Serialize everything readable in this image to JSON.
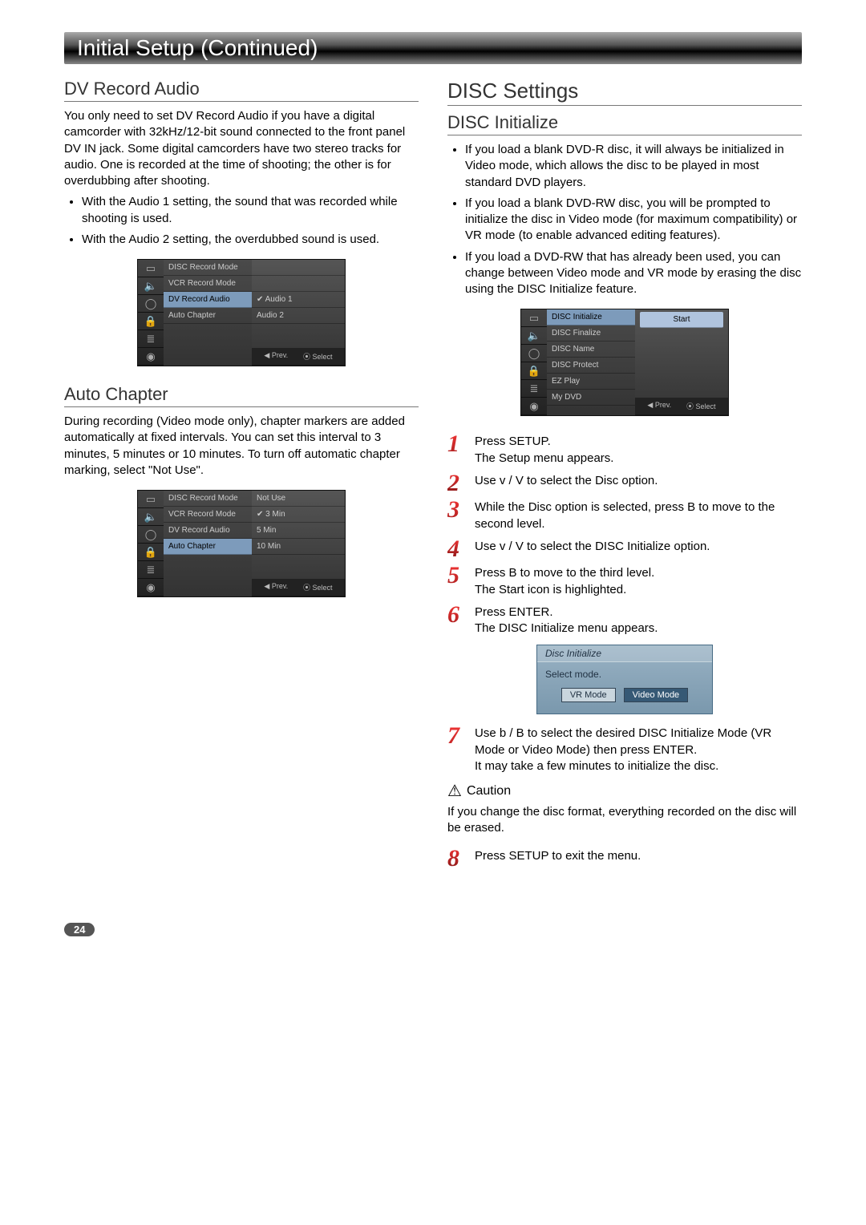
{
  "page_number": "24",
  "chapter_heading": "Initial Setup (Continued)",
  "left": {
    "h_dv": "DV Record Audio",
    "dv_p1": "You only need to set DV Record Audio if you have a digital camcorder with 32kHz/12-bit sound connected to the front panel DV IN jack. Some digital camcorders have two stereo tracks for audio. One is recorded at the time of shooting; the other is for overdubbing after shooting.",
    "dv_b1": "With the Audio 1 setting, the sound that was recorded while shooting is used.",
    "dv_b2": "With the Audio 2 setting, the overdubbed sound is used.",
    "menu_dv": {
      "items": [
        "DISC Record Mode",
        "VCR Record Mode",
        "DV Record Audio",
        "Auto Chapter"
      ],
      "highlight_index": 2,
      "values": [
        "",
        "",
        "Audio 1",
        "Audio 2"
      ],
      "check_index": 0,
      "footer_prev": "◀ Prev.",
      "footer_select": "⦿ Select"
    },
    "h_auto": "Auto Chapter",
    "auto_p1": "During recording (Video mode only), chapter markers are added automatically at fixed intervals. You can set this interval to 3 minutes, 5 minutes or 10 minutes. To turn off automatic chapter marking, select \"Not Use\".",
    "menu_auto": {
      "items": [
        "DISC Record Mode",
        "VCR Record Mode",
        "DV Record Audio",
        "Auto Chapter"
      ],
      "highlight_index": 3,
      "values": [
        "Not Use",
        "3 Min",
        "5 Min",
        "10 Min"
      ],
      "check_index": 1,
      "footer_prev": "◀ Prev.",
      "footer_select": "⦿ Select"
    }
  },
  "right": {
    "h_disc_settings": "DISC Settings",
    "h_disc_init": "DISC Initialize",
    "init_b1": "If you load a blank DVD-R disc, it will always be initialized in Video mode, which allows the disc to be played in most standard DVD players.",
    "init_b2": "If you load a blank DVD-RW disc, you will be prompted to initialize the disc in Video mode (for maximum compatibility) or VR mode (to enable advanced editing features).",
    "init_b3": "If you load a DVD-RW that has already been used, you can change between Video mode and VR mode by erasing the disc using the DISC Initialize feature.",
    "menu_init": {
      "items": [
        "DISC Initialize",
        "DISC Finalize",
        "DISC Name",
        "DISC Protect",
        "EZ Play",
        "My DVD"
      ],
      "highlight_index": 0,
      "button_label": "Start",
      "footer_prev": "◀ Prev.",
      "footer_select": "⦿ Select"
    },
    "steps": [
      "Press SETUP.\nThe Setup menu appears.",
      "Use v / V to select the Disc option.",
      "While the Disc option is selected, press B to move to the second level.",
      "Use v / V to select the DISC Initialize option.",
      "Press B to move to the third level.\nThe Start icon is highlighted.",
      "Press ENTER.\nThe DISC Initialize menu appears.",
      "Use b / B to select the desired DISC Initialize Mode (VR Mode or Video Mode) then press ENTER.\nIt may take a few minutes to initialize the disc.",
      "Press SETUP to exit the menu."
    ],
    "step_numbers": [
      "1",
      "2",
      "3",
      "4",
      "5",
      "6",
      "7",
      "8"
    ],
    "dialog": {
      "title": "Disc Initialize",
      "body": "Select mode.",
      "btn_vr": "VR Mode",
      "btn_video": "Video Mode"
    },
    "caution_label": "Caution",
    "caution_text": "If you change the disc format, everything recorded on the disc will be erased."
  }
}
